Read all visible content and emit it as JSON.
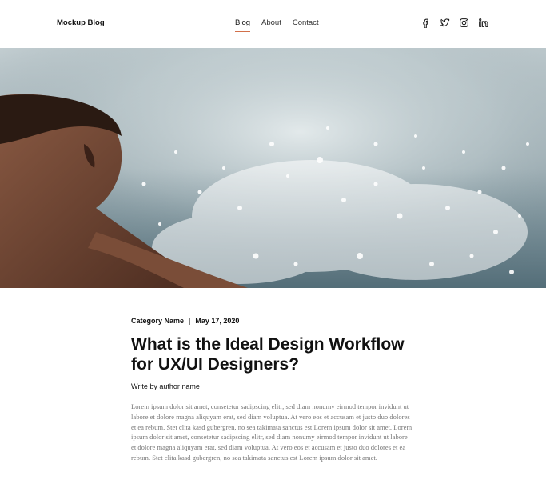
{
  "header": {
    "brand": "Mockup Blog",
    "nav": [
      {
        "label": "Blog",
        "active": true
      },
      {
        "label": "About",
        "active": false
      },
      {
        "label": "Contact",
        "active": false
      }
    ],
    "social_icons": [
      "facebook-icon",
      "twitter-icon",
      "instagram-icon",
      "linkedin-icon"
    ],
    "accent_color": "#d2704a"
  },
  "hero": {
    "image": "person-splashing-water"
  },
  "article": {
    "category": "Category Name",
    "separator": "|",
    "date": "May 17, 2020",
    "title": "What is the Ideal Design Workflow for UX/UI Designers?",
    "author": "Write by author name",
    "body": "Lorem ipsum dolor sit amet, consetetur sadipscing elitr, sed diam nonumy eirmod tempor invidunt ut labore et dolore magna aliquyam erat, sed diam voluptua. At vero eos et accusam et justo duo dolores et ea rebum. Stet clita kasd gubergren, no sea takimata sanctus est Lorem ipsum dolor sit amet. Lorem ipsum dolor sit amet, consetetur sadipscing elitr, sed diam nonumy eirmod tempor invidunt ut labore et dolore magna aliquyam erat, sed diam voluptua. At vero eos et accusam et justo duo dolores et ea rebum. Stet clita kasd gubergren, no sea takimata sanctus est Lorem ipsum dolor sit amet."
  }
}
